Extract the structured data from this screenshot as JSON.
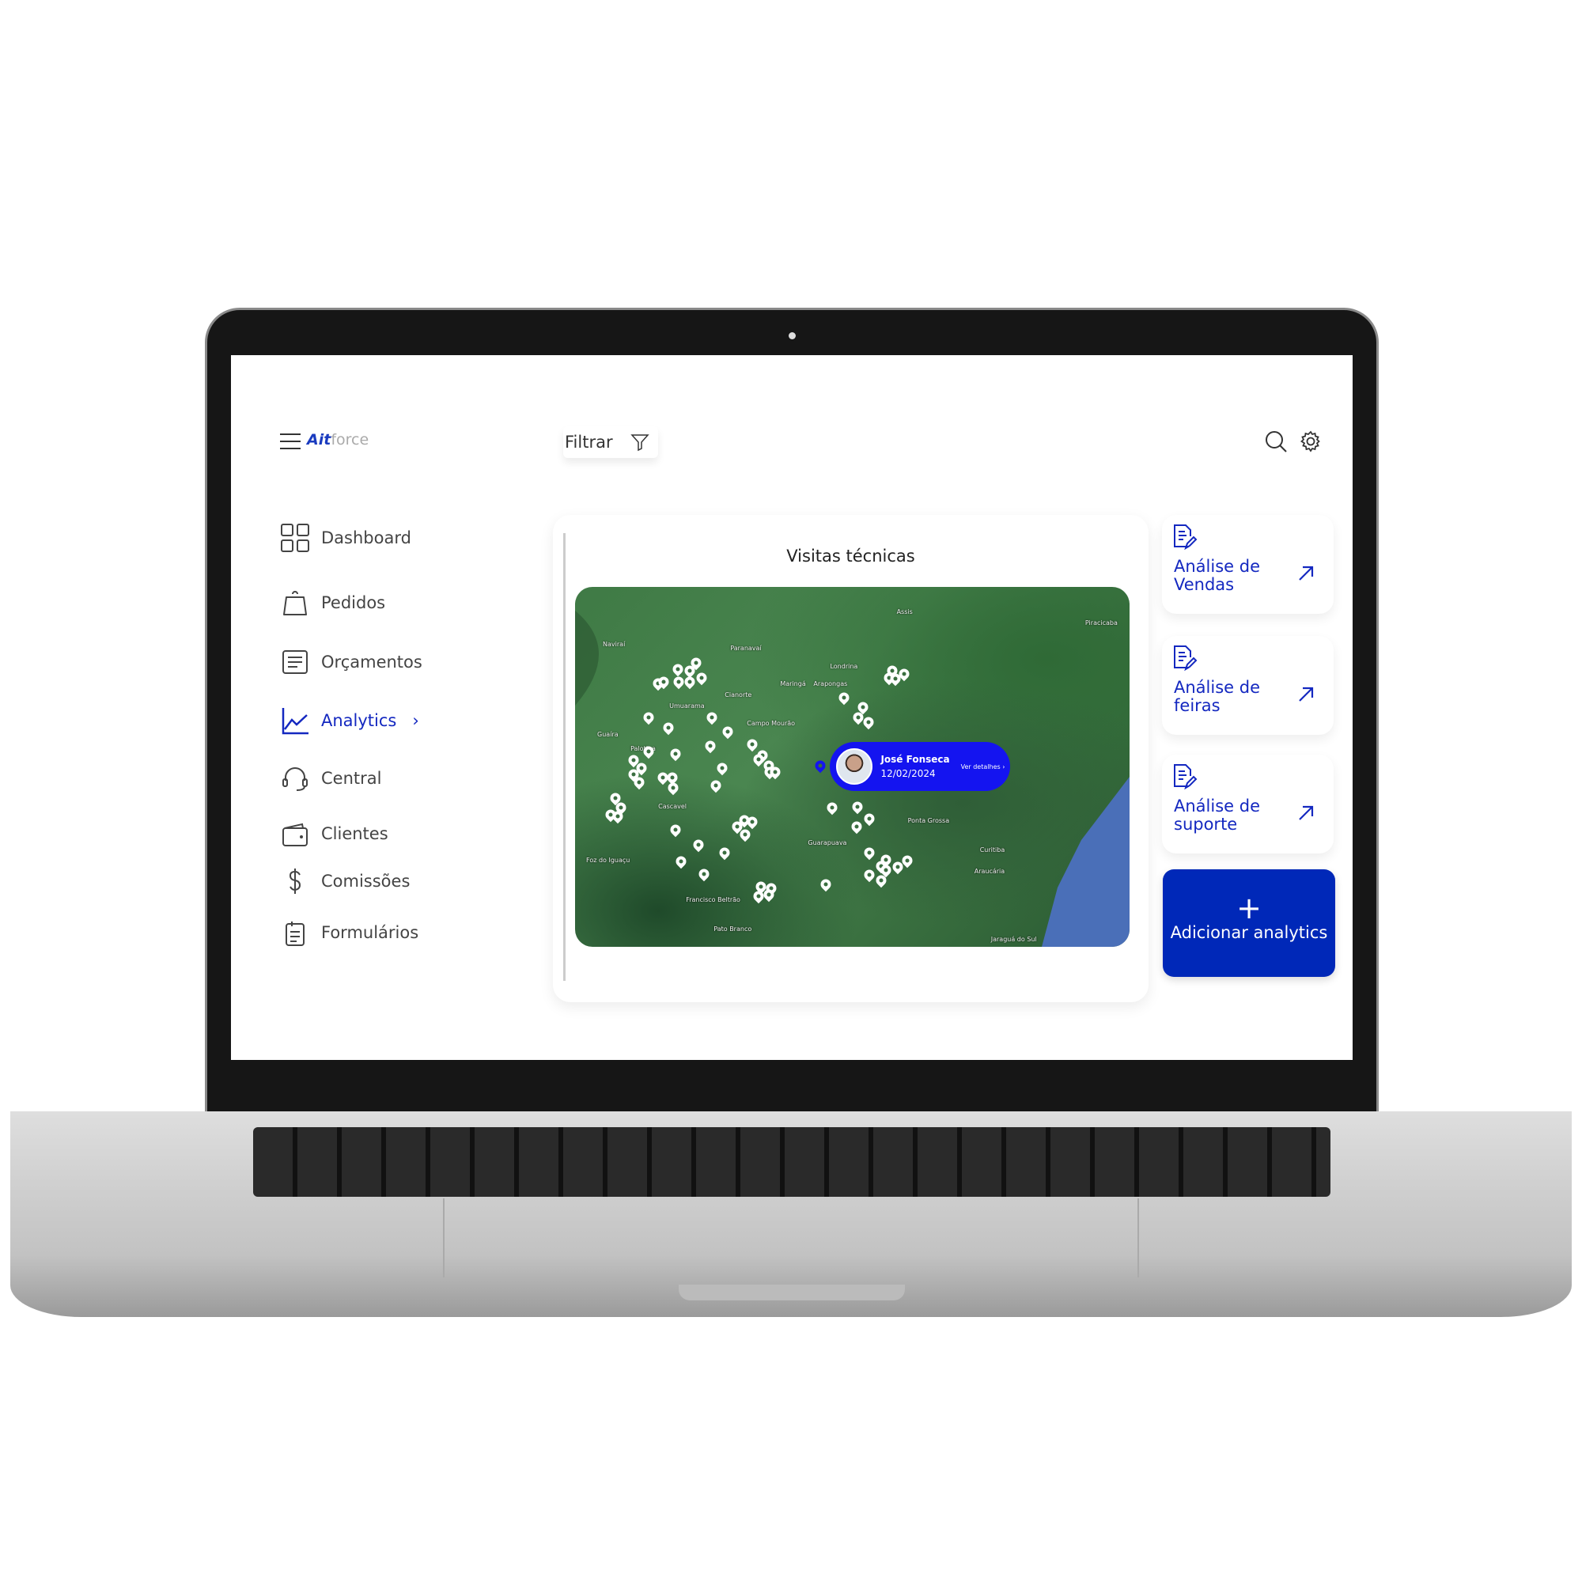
{
  "header": {
    "logo_mark": "Ait",
    "logo_text": "force",
    "filter_label": "Filtrar",
    "icons": [
      "menu-icon",
      "filter-icon",
      "search-icon",
      "gear-icon"
    ]
  },
  "sidebar": {
    "items": [
      {
        "label": "Dashboard",
        "icon": "grid-icon"
      },
      {
        "label": "Pedidos",
        "icon": "bag-icon"
      },
      {
        "label": "Orçamentos",
        "icon": "document-icon"
      },
      {
        "label": "Analytics",
        "icon": "chart-line-icon",
        "active": true
      },
      {
        "label": "Central",
        "icon": "headset-icon"
      },
      {
        "label": "Clientes",
        "icon": "wallet-icon"
      },
      {
        "label": "Comissões",
        "icon": "dollar-icon"
      },
      {
        "label": "Formulários",
        "icon": "clipboard-icon"
      }
    ]
  },
  "main": {
    "title": "Visitas técnicas",
    "map": {
      "labels": [
        "Naviraí",
        "Paranavaí",
        "Assis",
        "Piracicaba",
        "Londrina",
        "Maringá",
        "Arapongas",
        "Cianorte",
        "Umuarama",
        "Campo Mourão",
        "Guaíra",
        "Palotina",
        "Cascavel",
        "Ponta Grossa",
        "Guarapuava",
        "Curitiba",
        "Araucária",
        "Foz do Iguaçu",
        "Francisco Beltrão",
        "Pato Branco",
        "Jaraguá do Sul"
      ],
      "popup": {
        "name": "José Fonseca",
        "date": "12/02/2024",
        "link": "Ver detalhes"
      }
    }
  },
  "right": {
    "cards": [
      {
        "label": "Análise de Vendas"
      },
      {
        "label": "Análise de feiras"
      },
      {
        "label": "Análise de suporte"
      }
    ],
    "add_button": {
      "icon": "+",
      "label": "Adicionar analytics"
    }
  },
  "colors": {
    "accent": "#1428c0",
    "popup": "#1414f0",
    "button": "#0028b8"
  }
}
